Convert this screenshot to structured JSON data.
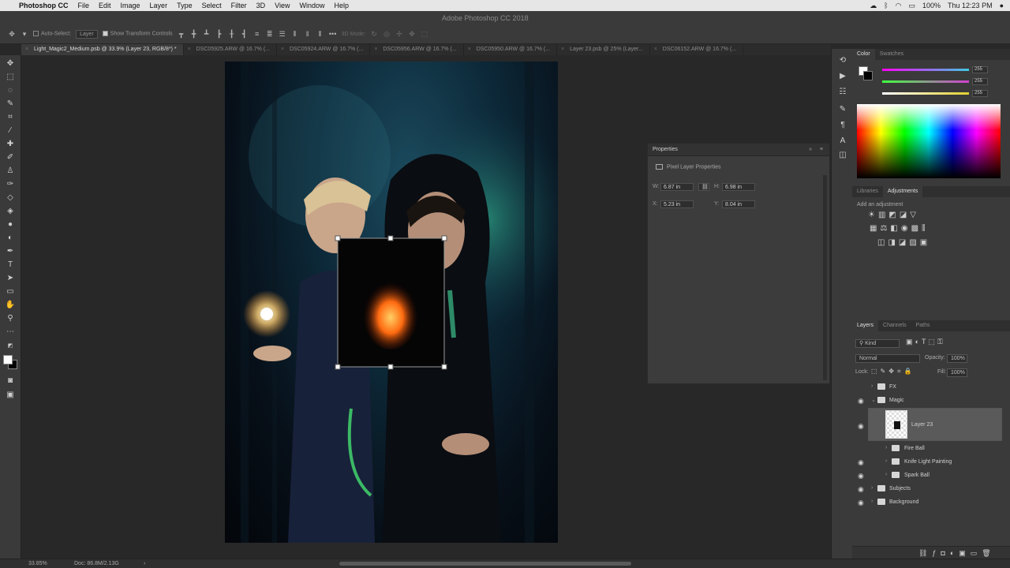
{
  "menubar": {
    "app_name": "Photoshop CC",
    "items": [
      "File",
      "Edit",
      "Image",
      "Layer",
      "Type",
      "Select",
      "Filter",
      "3D",
      "View",
      "Window",
      "Help"
    ],
    "battery": "100%",
    "clock": "Thu 12:23 PM"
  },
  "window_title": "Adobe Photoshop CC 2018",
  "options_bar": {
    "auto_select_label": "Auto-Select:",
    "auto_select_value": "Layer",
    "show_transform_label": "Show Transform Controls",
    "mode_3d_label": "3D Mode:"
  },
  "tabs": [
    "Light_Magic2_Medium.psb @ 33.9% (Layer 23, RGB/8*) *",
    "DSC05925.ARW @ 16.7% (...",
    "DSC05924.ARW @ 16.7% (...",
    "DSC05956.ARW @ 16.7% (...",
    "DSC05950.ARW @ 16.7% (...",
    "Layer 23.psb @ 25% (Layer...",
    "DSC06152.ARW @ 16.7% (..."
  ],
  "properties": {
    "title": "Properties",
    "subtitle": "Pixel Layer Properties",
    "w_label": "W:",
    "w_value": "6.87 in",
    "h_label": "H:",
    "h_value": "6.98 in",
    "x_label": "X:",
    "x_value": "5.23 in",
    "y_label": "Y:",
    "y_value": "8.04 in"
  },
  "color_panel": {
    "tabs": [
      "Color",
      "Swatches"
    ],
    "values": [
      "255",
      "255",
      "255"
    ],
    "slider_colors": [
      "#40c8e0",
      "#d040d0",
      "#e0d030"
    ]
  },
  "adjustments_panel": {
    "tabs": [
      "Libraries",
      "Adjustments"
    ],
    "hint": "Add an adjustment"
  },
  "layers_panel": {
    "tabs": [
      "Layers",
      "Channels",
      "Paths"
    ],
    "kind_label": "Kind",
    "blend_mode": "Normal",
    "opacity_label": "Opacity:",
    "opacity_value": "100%",
    "lock_label": "Lock:",
    "fill_label": "Fill:",
    "fill_value": "100%",
    "layers": [
      {
        "name": "FX",
        "visible": false
      },
      {
        "name": "Magic",
        "visible": true
      },
      {
        "name": "Layer 23",
        "visible": true
      },
      {
        "name": "Fire Ball",
        "visible": false
      },
      {
        "name": "Knife Light Painting",
        "visible": true
      },
      {
        "name": "Spark Ball",
        "visible": true
      },
      {
        "name": "Subjects",
        "visible": true
      },
      {
        "name": "Background",
        "visible": true
      }
    ]
  },
  "status_bar": {
    "zoom": "33.85%",
    "doc_size": "Doc: 86.8M/2.13G"
  },
  "icons": {
    "menubar_right": [
      "creative-cloud-icon",
      "bluetooth-icon",
      "wifi-icon",
      "battery-icon",
      "user-icon"
    ],
    "tools": [
      "move-icon",
      "marquee-icon",
      "lasso-icon",
      "quick-select-icon",
      "crop-icon",
      "eyedropper-icon",
      "healing-icon",
      "brush-icon",
      "clone-stamp-icon",
      "history-brush-icon",
      "eraser-icon",
      "gradient-icon",
      "blur-icon",
      "dodge-icon",
      "pen-icon",
      "type-icon",
      "path-select-icon",
      "rectangle-icon",
      "hand-icon",
      "zoom-icon"
    ]
  }
}
